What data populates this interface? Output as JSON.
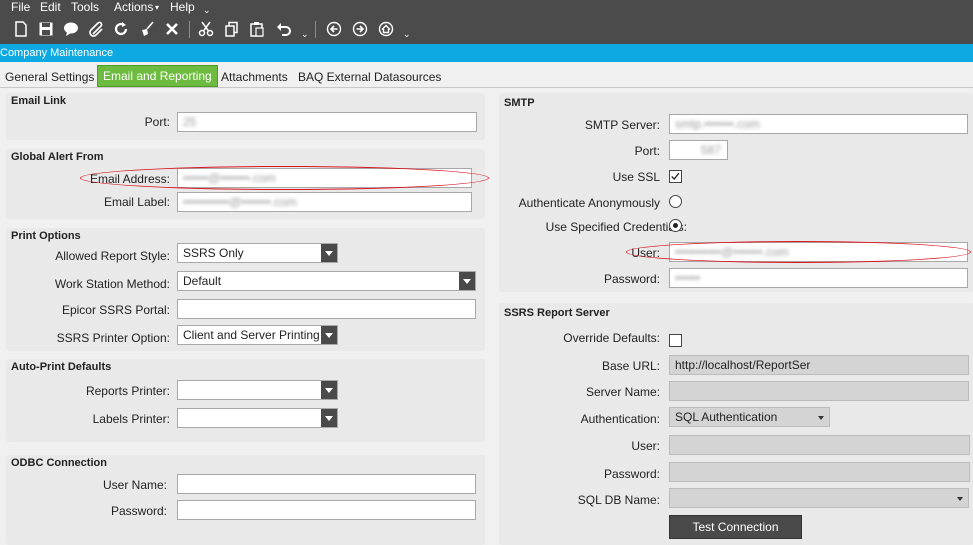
{
  "menu": [
    "File",
    "Edit",
    "Tools",
    "Actions",
    "Help"
  ],
  "window_title": "Company Maintenance",
  "tabs": [
    "General Settings",
    "Email and Reporting",
    "Attachments",
    "BAQ External Datasources"
  ],
  "email_link": {
    "title": "Email Link",
    "port_label": "Port:",
    "port_value": "25"
  },
  "global_alert": {
    "title": "Global Alert From",
    "email_address_label": "Email Address:",
    "email_address_value": "••••••@•••••••.com",
    "email_label_label": "Email Label:",
    "email_label_value": "•••••••••••@•••••••.com"
  },
  "print_options": {
    "title": "Print Options",
    "allowed_report_style_label": "Allowed Report Style:",
    "allowed_report_style_value": "SSRS Only",
    "work_station_method_label": "Work Station Method:",
    "work_station_method_value": "Default",
    "epicor_ssrs_portal_label": "Epicor SSRS Portal:",
    "epicor_ssrs_portal_value": "",
    "ssrs_printer_option_label": "SSRS Printer Option:",
    "ssrs_printer_option_value": "Client and Server Printing"
  },
  "auto_print": {
    "title": "Auto-Print Defaults",
    "reports_printer_label": "Reports Printer:",
    "reports_printer_value": "",
    "labels_printer_label": "Labels Printer:",
    "labels_printer_value": ""
  },
  "odbc": {
    "title": "ODBC Connection",
    "user_name_label": "User Name:",
    "user_name_value": "",
    "password_label": "Password:",
    "password_value": ""
  },
  "smtp": {
    "title": "SMTP",
    "server_label": "SMTP Server:",
    "server_value": "smtp.•••••••.com",
    "port_label": "Port:",
    "port_value": "587",
    "use_ssl_label": "Use SSL",
    "use_ssl_checked": true,
    "auth_anon_label": "Authenticate Anonymously",
    "use_creds_label": "Use Specified Credentials:",
    "selected_auth": "specified",
    "user_label": "User:",
    "user_value": "•••••••••••@•••••••.com",
    "password_label": "Password:",
    "password_value": "••••••"
  },
  "ssrs": {
    "title": "SSRS Report Server",
    "override_label": "Override Defaults:",
    "override_checked": false,
    "base_url_label": "Base URL:",
    "base_url_value": "http://localhost/ReportSer",
    "server_name_label": "Server Name:",
    "server_name_value": "",
    "authentication_label": "Authentication:",
    "authentication_value": "SQL Authentication",
    "user_label": "User:",
    "user_value": "",
    "password_label": "Password:",
    "password_value": "",
    "sql_db_label": "SQL DB Name:",
    "sql_db_value": "",
    "test_button": "Test Connection"
  }
}
